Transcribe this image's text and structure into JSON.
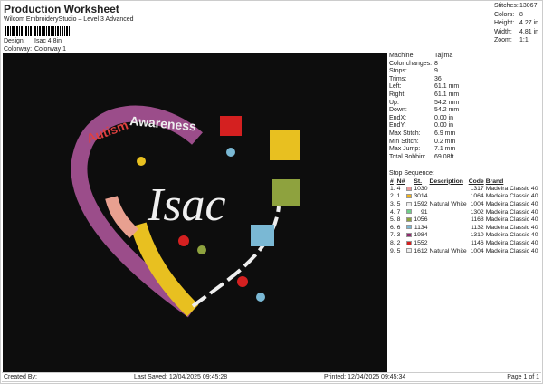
{
  "header": {
    "title": "Production Worksheet",
    "subtitle": "Wilcom EmbroideryStudio – Level 3 Advanced",
    "design_label": "Design:",
    "design": "Isac 4.8in",
    "colorway_label": "Colorway:",
    "colorway": "Colorway 1"
  },
  "stats": [
    {
      "k": "Stitches:",
      "v": "13067"
    },
    {
      "k": "Colors:",
      "v": "8"
    },
    {
      "k": "Height:",
      "v": "4.27 in"
    },
    {
      "k": "Width:",
      "v": "4.81 in"
    },
    {
      "k": "Zoom:",
      "v": "1:1"
    }
  ],
  "info": [
    {
      "k": "Machine:",
      "v": "Tajima"
    },
    {
      "k": "Color changes:",
      "v": "8"
    },
    {
      "k": "Stops:",
      "v": "9"
    },
    {
      "k": "Trims:",
      "v": "36"
    },
    {
      "k": "Left:",
      "v": "61.1 mm"
    },
    {
      "k": "Right:",
      "v": "61.1 mm"
    },
    {
      "k": "Up:",
      "v": "54.2 mm"
    },
    {
      "k": "Down:",
      "v": "54.2 mm"
    },
    {
      "k": "EndX:",
      "v": "0.00 in"
    },
    {
      "k": "EndY:",
      "v": "0.00 in"
    },
    {
      "k": "Max Stitch:",
      "v": "6.9 mm"
    },
    {
      "k": "Min Stitch:",
      "v": "0.2 mm"
    },
    {
      "k": "Max Jump:",
      "v": "7.1 mm"
    },
    {
      "k": "Total Bobbin:",
      "v": "69.08ft"
    }
  ],
  "sequence": {
    "title": "Stop Sequence:",
    "headers": [
      "#",
      "N#",
      "St.",
      "Description",
      "Code",
      "Brand"
    ],
    "rows": [
      {
        "n": "1.",
        "nn": "4",
        "color": "#e89a9a",
        "st": "1030",
        "desc": "",
        "code": "1317",
        "brand": "Madeira Classic 40"
      },
      {
        "n": "2.",
        "nn": "1",
        "color": "#f2b51c",
        "st": "3014",
        "desc": "",
        "code": "1064",
        "brand": "Madeira Classic 40"
      },
      {
        "n": "3.",
        "nn": "5",
        "color": "#eeeeee",
        "st": "1592",
        "desc": "Natural White",
        "code": "1004",
        "brand": "Madeira Classic 40"
      },
      {
        "n": "4.",
        "nn": "7",
        "color": "#6fcf8a",
        "st": "91",
        "desc": "",
        "code": "1302",
        "brand": "Madeira Classic 40"
      },
      {
        "n": "5.",
        "nn": "8",
        "color": "#8ea23e",
        "st": "1056",
        "desc": "",
        "code": "1168",
        "brand": "Madeira Classic 40"
      },
      {
        "n": "6.",
        "nn": "6",
        "color": "#7ab8d4",
        "st": "1134",
        "desc": "",
        "code": "1132",
        "brand": "Madeira Classic 40"
      },
      {
        "n": "7.",
        "nn": "3",
        "color": "#8e2a6e",
        "st": "1984",
        "desc": "",
        "code": "1310",
        "brand": "Madeira Classic 40"
      },
      {
        "n": "8.",
        "nn": "2",
        "color": "#d42020",
        "st": "1552",
        "desc": "",
        "code": "1146",
        "brand": "Madeira Classic 40"
      },
      {
        "n": "9.",
        "nn": "5",
        "color": "#eeeeee",
        "st": "1612",
        "desc": "Natural White",
        "code": "1004",
        "brand": "Madeira Classic 40"
      }
    ]
  },
  "design_art": {
    "name_text": "Isac",
    "banner_text_1": "Autism",
    "banner_text_2": "Awareness"
  },
  "footer": {
    "created": "Created By:",
    "saved": "Last Saved: 12/04/2025 09:45:28",
    "printed": "Printed: 12/04/2025 09:45:34",
    "page": "Page 1 of 1"
  }
}
